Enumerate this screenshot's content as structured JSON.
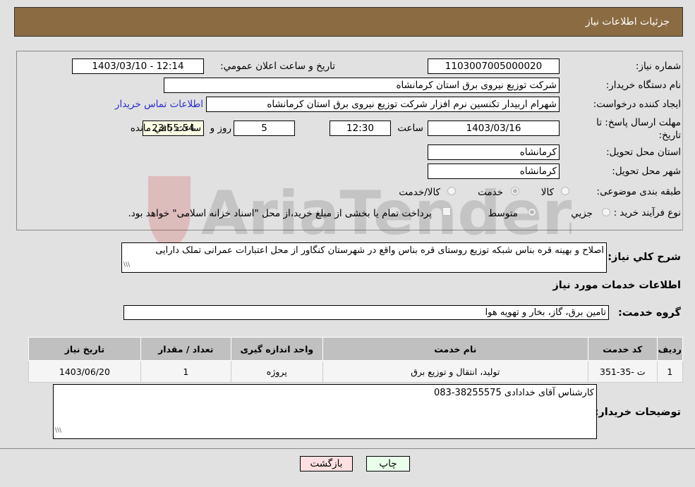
{
  "header": {
    "title": "جزئیات اطلاعات نیاز"
  },
  "fields": {
    "need_number": {
      "label": "شماره نیاز:",
      "value": "1103007005000020"
    },
    "announce": {
      "label": "تاریخ و ساعت اعلان عمومي:",
      "value": "1403/03/10 - 12:14"
    },
    "buyer_org": {
      "label": "نام دستگاه خریدار:",
      "value": "شرکت توزیع نیروی برق استان کرمانشاه"
    },
    "creator": {
      "label": "ایجاد کننده درخواست:",
      "value": "شهرام اربیدار تکنسین نرم افزار شرکت توزیع نیروی برق استان کرمانشاه",
      "contact_link": "اطلاعات تماس خریدار"
    },
    "deadline": {
      "label": "مهلت ارسال پاسخ: تا تاریخ:",
      "date": "1403/03/16",
      "time_label": "ساعت",
      "time": "12:30",
      "days": "5",
      "days_label": "روز و",
      "remaining": "23:55:54",
      "remaining_label": "ساعت باقي مانده"
    },
    "province": {
      "label": "استان محل تحویل:",
      "value": "کرمانشاه"
    },
    "city": {
      "label": "شهر محل تحویل:",
      "value": "کرمانشاه"
    },
    "category": {
      "label": "طبقه بندی موضوعی:",
      "options": [
        "کالا",
        "خدمت",
        "کالا/خدمت"
      ],
      "selected": "خدمت"
    },
    "process": {
      "label": "نوع فرآیند خرید :",
      "options": [
        "جزيي",
        "متوسط"
      ],
      "selected": "متوسط",
      "checkbox_label": "پرداخت تمام یا بخشی از مبلغ خرید،از محل \"اسناد خزانه اسلامی\" خواهد بود."
    }
  },
  "description": {
    "label": "شرح كلي نياز:",
    "value": "اصلاح و بهینه قره بناس شبکه توزیع روستای قره بناس واقع در شهرستان کنگاور از محل اعتبارات عمرانی تملک دارایی"
  },
  "services_title": "اطلاعات خدمات مورد نیاز",
  "service_group": {
    "label": "گروه خدمت:",
    "value": "تامین برق، گاز، بخار و تهویه هوا"
  },
  "table": {
    "headers": [
      "ردیف",
      "کد خدمت",
      "نام خدمت",
      "واحد اندازه گیری",
      "تعداد / مقدار",
      "تاریخ نیاز"
    ],
    "rows": [
      [
        "1",
        "ت -35-351",
        "تولید، انتقال و توزیع برق",
        "پروژه",
        "1",
        "1403/06/20"
      ]
    ]
  },
  "buyer_notes": {
    "label": "توضیحات خریدار:",
    "value": "کارشناس آقای خدادادی 38255575-083"
  },
  "buttons": {
    "print": "چاپ",
    "back": "بازگشت"
  },
  "colors": {
    "header_bg": "#8b6b42",
    "print_bg": "#eaffea",
    "back_bg": "#ffe0e0",
    "link": "#2a2ad0"
  },
  "watermark": "AriaTender.net"
}
